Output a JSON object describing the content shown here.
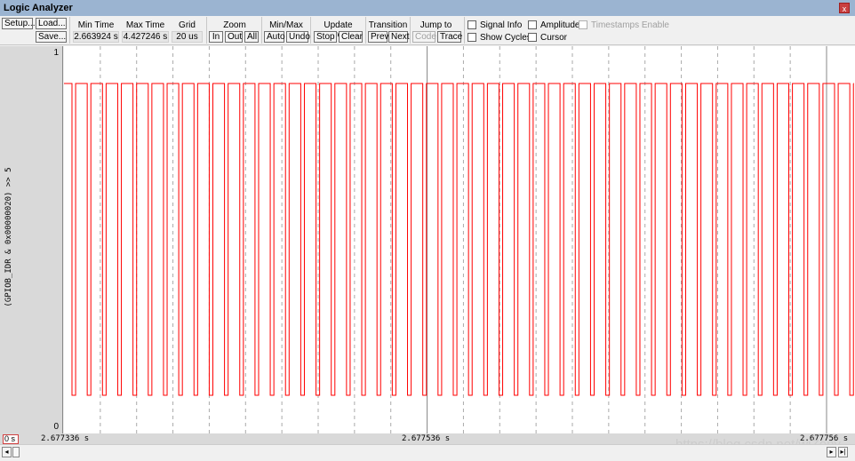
{
  "window": {
    "title": "Logic Analyzer",
    "close_icon": "close-icon"
  },
  "toolbar": {
    "setup": "Setup...",
    "load": "Load...",
    "save": "Save...",
    "min_time_label": "Min Time",
    "min_time": "2.663924 s",
    "max_time_label": "Max Time",
    "max_time": "4.427246 s",
    "grid_label": "Grid",
    "grid": "20 us",
    "zoom_label": "Zoom",
    "zoom_in": "In",
    "zoom_out": "Out",
    "zoom_all": "All",
    "minmax_label": "Min/Max",
    "auto": "Auto",
    "undo": "Undo",
    "update_label": "Update Screen",
    "stop": "Stop",
    "clear": "Clear",
    "transition_label": "Transition",
    "prev": "Prev",
    "next": "Next",
    "jump_label": "Jump to",
    "code": "Code",
    "trace": "Trace",
    "signal_info": "Signal Info",
    "amplitude": "Amplitude",
    "timestamps": "Timestamps Enable",
    "show_cycles": "Show Cycles",
    "cursor": "Cursor"
  },
  "signal": {
    "label": "(GPIOB_IDR & 0x00000020) >> 5",
    "ymax": "1",
    "ymin": "0",
    "color": "#ff0000"
  },
  "timeaxis": {
    "zoom_field": "0 s",
    "left": "2.677336 s",
    "center": "2.677536 s",
    "right": "2.677756 s"
  },
  "watermark": "https://blog.csdn.net/wiZony",
  "chart_data": {
    "type": "line",
    "x_start_s": 2.677336,
    "x_end_s": 2.677756,
    "grid_us": 20,
    "ylim": [
      0,
      1
    ],
    "waveform": {
      "kind": "periodic-pulse",
      "high": 1,
      "low": 0,
      "period_us": 8.4,
      "low_duration_us": 2.0,
      "first_fall_offset_us": 4.4
    }
  }
}
